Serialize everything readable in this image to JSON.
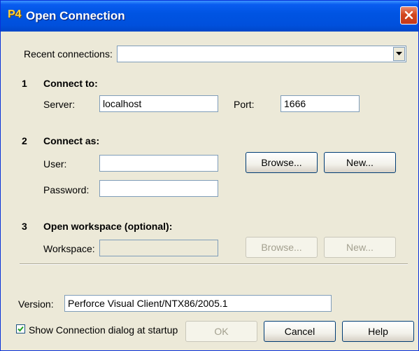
{
  "window": {
    "title": "Open Connection",
    "app_icon": "perforce-p4-icon"
  },
  "recent": {
    "label": "Recent connections:",
    "value": ""
  },
  "section1": {
    "number": "1",
    "title": "Connect to:"
  },
  "server": {
    "label": "Server:",
    "value": "localhost"
  },
  "port": {
    "label": "Port:",
    "value": "1666"
  },
  "section2": {
    "number": "2",
    "title": "Connect as:"
  },
  "user": {
    "label": "User:",
    "value": "",
    "browse": "Browse...",
    "new": "New..."
  },
  "password": {
    "label": "Password:",
    "value": ""
  },
  "section3": {
    "number": "3",
    "title": "Open workspace (optional):"
  },
  "workspace": {
    "label": "Workspace:",
    "value": "",
    "browse": "Browse...",
    "new": "New..."
  },
  "version": {
    "label": "Version:",
    "value": "Perforce Visual Client/NTX86/2005.1"
  },
  "startup": {
    "label": "Show Connection dialog at startup",
    "checked": true
  },
  "footer": {
    "ok": "OK",
    "cancel": "Cancel",
    "help": "Help"
  }
}
